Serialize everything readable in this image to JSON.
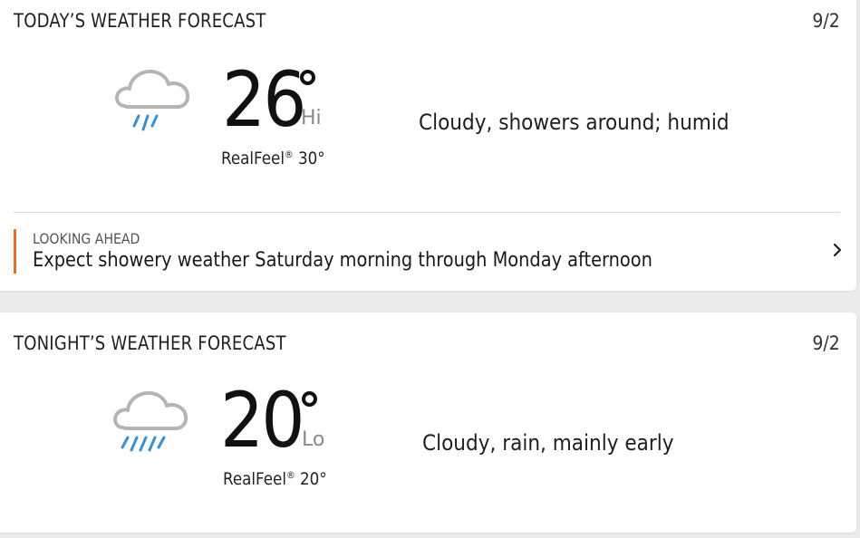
{
  "today": {
    "title": "TODAY’S WEATHER FORECAST",
    "date": "9/2",
    "temperature": "26",
    "hilo": "Hi",
    "realfeel_label": "RealFeel",
    "realfeel_value": "30°",
    "phrase": "Cloudy, showers around; humid",
    "icon": "cloud-showers-icon"
  },
  "looking_ahead": {
    "label": "LOOKING AHEAD",
    "text": "Expect showery weather Saturday morning through Monday afternoon",
    "icon": "chevron-right-icon"
  },
  "tonight": {
    "title": "TONIGHT’S WEATHER FORECAST",
    "date": "9/2",
    "temperature": "20",
    "hilo": "Lo",
    "realfeel_label": "RealFeel",
    "realfeel_value": "20°",
    "phrase": "Cloudy, rain, mainly early",
    "icon": "cloud-rain-icon"
  },
  "colors": {
    "accent": "#e0702a",
    "rain": "#3a8fd0",
    "cloud": "#b5b5b5",
    "background": "#ebebeb"
  }
}
